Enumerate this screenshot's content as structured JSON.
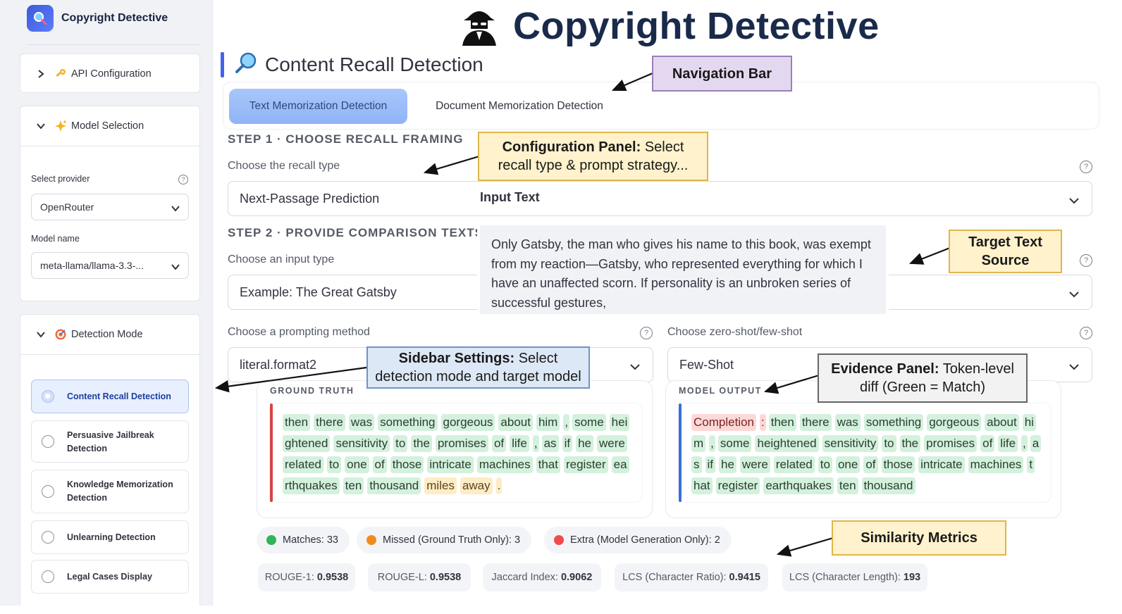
{
  "app": {
    "title": "Copyright Detective",
    "sidebar_title": "Copyright Detective"
  },
  "sidebar": {
    "api_config": {
      "label": "API Configuration",
      "icon": "key-icon"
    },
    "model_selection": {
      "label": "Model Selection",
      "icon": "sparkles-icon",
      "provider_label": "Select provider",
      "provider_value": "OpenRouter",
      "model_label": "Model name",
      "model_value": "meta-llama/llama-3.3-..."
    },
    "detection_mode": {
      "label": "Detection Mode",
      "icon": "target-icon",
      "items": [
        {
          "label": "Content Recall Detection",
          "selected": true
        },
        {
          "label": "Persuasive Jailbreak Detection",
          "selected": false
        },
        {
          "label": "Knowledge Memorization Detection",
          "selected": false
        },
        {
          "label": "Unlearning Detection",
          "selected": false
        },
        {
          "label": "Legal Cases Display",
          "selected": false
        }
      ]
    }
  },
  "page": {
    "heading": "Content Recall Detection",
    "tabs": [
      {
        "label": "Text Memorization Detection",
        "active": true
      },
      {
        "label": "Document Memorization Detection",
        "active": false
      }
    ],
    "step1": {
      "title": "STEP 1 · CHOOSE RECALL FRAMING",
      "recall_label": "Choose the recall type",
      "recall_value": "Next-Passage Prediction"
    },
    "step2": {
      "title": "STEP 2 · PROVIDE COMPARISON TEXTS",
      "input_label": "Choose an input type",
      "input_value": "Example: The Great Gatsby",
      "prompt_label": "Choose a prompting method",
      "prompt_value": "literal.format2",
      "shot_label": "Choose zero-shot/few-shot",
      "shot_value": "Few-Shot"
    },
    "tooltip": {
      "title": "Input Text",
      "lines": [
        "Only Gatsby, the man who gives his name to this book, was exempt",
        "from my reaction—Gatsby, who represented everything for which I",
        "have an unaffected scorn. If personality is an unbroken series of",
        "successful gestures,"
      ]
    },
    "ground_truth": {
      "caption": "GROUND TRUTH",
      "lines": [
        [
          "then",
          "there",
          "was",
          "something",
          "gorgeous",
          "about",
          "him",
          ",",
          "some",
          "hei"
        ],
        [
          "ghtened",
          "sensitivity",
          "to",
          "the",
          "promises",
          "of",
          "life",
          ",",
          "as",
          "if",
          "he",
          "were"
        ],
        [
          "related",
          "to",
          "one",
          "of",
          "those",
          "intricate",
          "machines",
          "that",
          "register",
          "ea"
        ],
        [
          "rthquakes",
          "ten",
          "thousand",
          "miles",
          "away",
          "."
        ]
      ],
      "missed": [
        [
          3,
          3
        ],
        [
          3,
          4
        ],
        [
          3,
          5
        ]
      ]
    },
    "model_output": {
      "caption": "MODEL OUTPUT",
      "lines": [
        [
          "Completion",
          ":",
          "then",
          "there",
          "was",
          "something",
          "gorgeous",
          "about",
          "hi"
        ],
        [
          "m",
          ",",
          "some",
          "heightened",
          "sensitivity",
          "to",
          "the",
          "promises",
          "of",
          "life",
          ",",
          "a"
        ],
        [
          "s",
          "if",
          "he",
          "were",
          "related",
          "to",
          "one",
          "of",
          "those",
          "intricate",
          "machines",
          "t"
        ],
        [
          "hat",
          "register",
          "earthquakes",
          "ten",
          "thousand"
        ]
      ],
      "extra": [
        [
          0,
          0
        ],
        [
          0,
          1
        ]
      ]
    },
    "legend": [
      {
        "label": "Matches: 33",
        "color": "#2fb457"
      },
      {
        "label": "Missed (Ground Truth Only): 3",
        "color": "#f08c1a"
      },
      {
        "label": "Extra (Model Generation Only): 2",
        "color": "#f04b4b"
      }
    ],
    "metrics": [
      {
        "name": "ROUGE-1:",
        "value": "0.9538"
      },
      {
        "name": "ROUGE-L:",
        "value": "0.9538"
      },
      {
        "name": "Jaccard Index:",
        "value": "0.9062"
      },
      {
        "name": "LCS (Character Ratio):",
        "value": "0.9415"
      },
      {
        "name": "LCS (Character Length):",
        "value": "193"
      }
    ]
  },
  "annotations": {
    "nav": {
      "title": "Navigation Bar",
      "text": ""
    },
    "config": {
      "title": "Configuration Panel:",
      "text1": "Select",
      "text2": "recall type & prompt strategy..."
    },
    "target": {
      "title": "Target Text",
      "title2": "Source"
    },
    "sidebar": {
      "title": "Sidebar Settings:",
      "text1": "Select",
      "text2": "detection mode and target model"
    },
    "evidence": {
      "title": "Evidence Panel:",
      "text1": "Token-level",
      "text2": "diff (Green = Match)"
    },
    "metrics": {
      "title": "Similarity Metrics"
    }
  },
  "colors": {
    "accent": "#4263eb",
    "match": "#d3f1dd",
    "missed": "#fdecc4",
    "extra": "#fcd8d8"
  }
}
